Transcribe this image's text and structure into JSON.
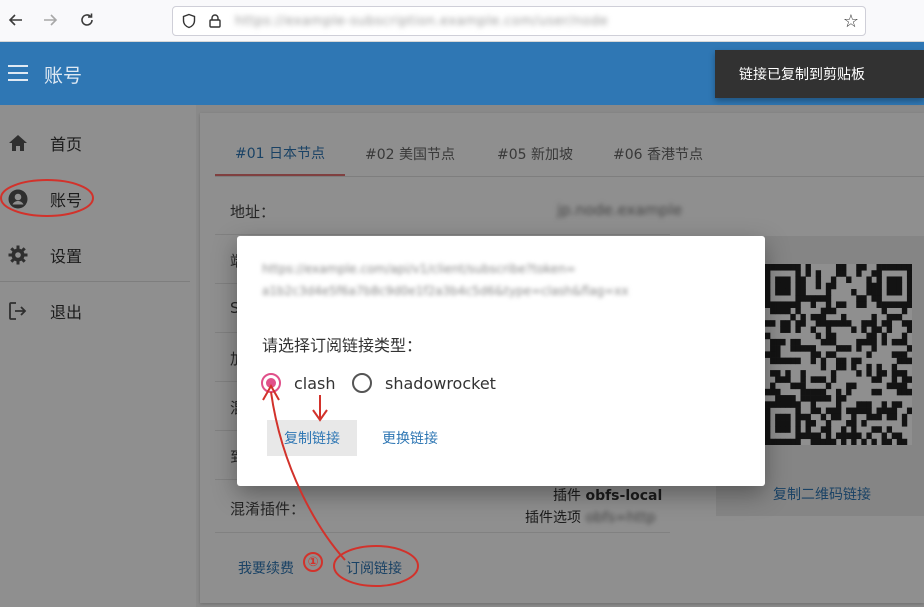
{
  "browser": {
    "url": "https://example-subscription.example.com/user/node",
    "icons": {
      "back": "arrow-left-icon",
      "forward": "arrow-right-icon",
      "reload": "reload-icon",
      "shield": "shield-icon",
      "lock": "lock-icon",
      "bookmark": "star-icon"
    }
  },
  "appbar": {
    "title": "账号",
    "menu_icon": "hamburger-icon"
  },
  "toast": {
    "text": "链接已复制到剪贴板"
  },
  "sidebar": {
    "items": [
      {
        "label": "首页",
        "icon": "home-icon"
      },
      {
        "label": "账号",
        "icon": "account-circle-icon"
      },
      {
        "label": "设置",
        "icon": "gear-icon"
      },
      {
        "label": "退出",
        "icon": "logout-icon"
      }
    ]
  },
  "tabs": [
    "#01 日本节点",
    "#02 美国节点",
    "#05 新加坡",
    "#06 香港节点"
  ],
  "info": {
    "address_label": "地址：",
    "address_value": "jp.node.example",
    "port_label": "端",
    "s_label": "S",
    "enc_label": "加",
    "mix_label": "混",
    "expire_label": "到",
    "obfs_label": "混淆插件：",
    "plugin_line1_prefix": "插件 ",
    "plugin_line1_value": "obfs-local",
    "plugin_line2_prefix": "插件选项 ",
    "plugin_line2_value": "obfs=http"
  },
  "qr": {
    "link_label": "复制二维码链接"
  },
  "actions": {
    "renew": "我要续费",
    "subscribe": "订阅链接"
  },
  "dialog": {
    "url_line1": "https://example.com/api/v1/client/subscribe?token=",
    "url_line2": "a1b2c3d4e5f6a7b8c9d0e1f2a3b4c5d6&type=clash&flag=xx",
    "prompt": "请选择订阅链接类型：",
    "options": [
      {
        "label": "clash",
        "checked": true
      },
      {
        "label": "shadowrocket",
        "checked": false
      }
    ],
    "copy_button": "复制链接",
    "change_button": "更换链接"
  },
  "annotation": {
    "step": "①",
    "color": "#d2322b"
  },
  "colors": {
    "primary": "#2f77b4",
    "accent": "#e0508a",
    "toast_bg": "#323232"
  }
}
